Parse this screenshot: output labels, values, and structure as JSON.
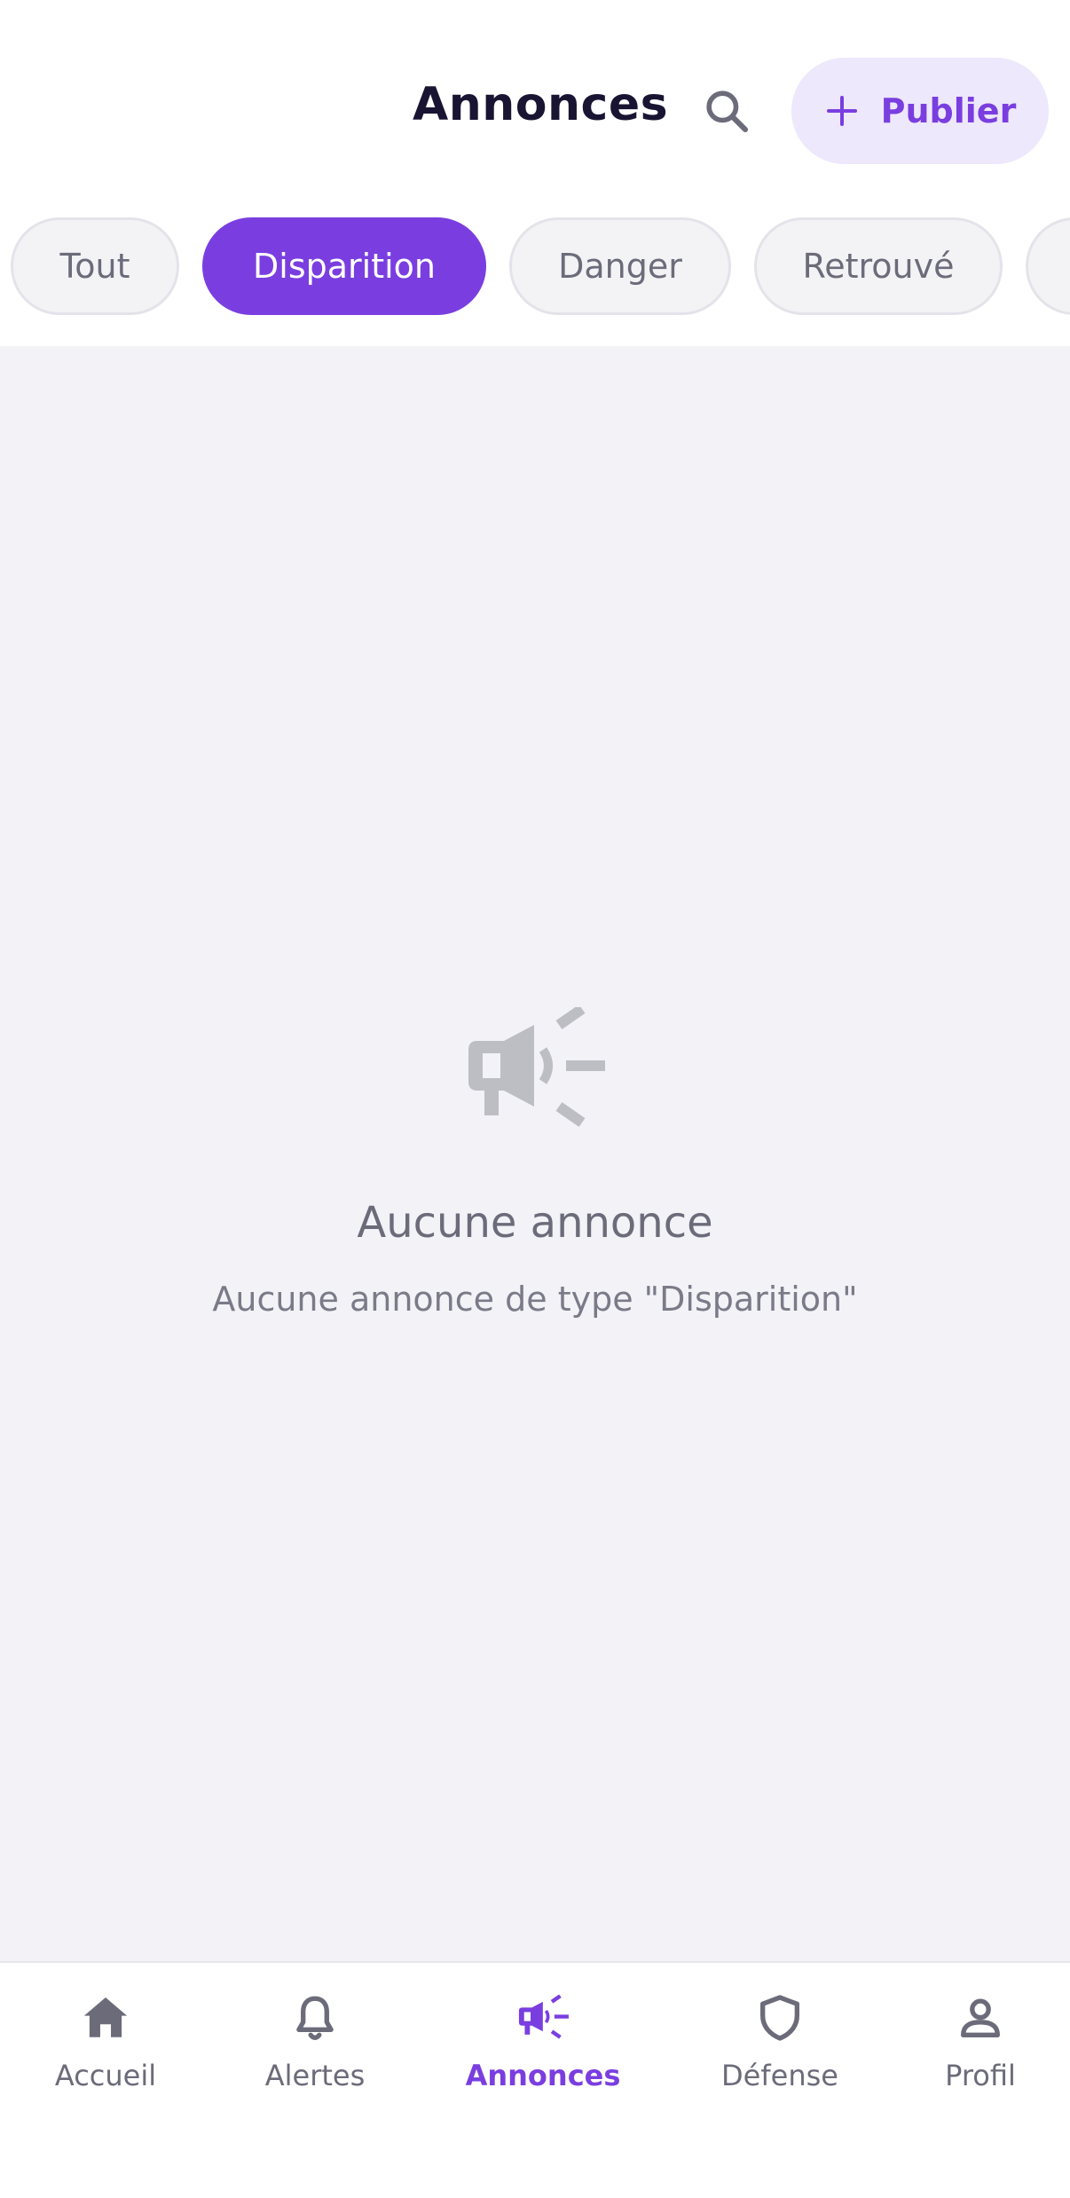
{
  "header": {
    "title": "Annonces",
    "search_icon": "search-icon",
    "publish_label": "Publier",
    "publish_icon": "plus-icon"
  },
  "filters": {
    "selected": "Disparition",
    "items": [
      {
        "label": "Tout"
      },
      {
        "label": "Disparition"
      },
      {
        "label": "Danger"
      },
      {
        "label": "Retrouvé"
      }
    ]
  },
  "empty_state": {
    "icon": "megaphone-icon",
    "title": "Aucune annonce",
    "subtitle": "Aucune annonce de type \"Disparition\""
  },
  "bottom_nav": {
    "active": "Annonces",
    "items": [
      {
        "label": "Accueil",
        "icon": "home-icon"
      },
      {
        "label": "Alertes",
        "icon": "bell-icon"
      },
      {
        "label": "Annonces",
        "icon": "megaphone-icon"
      },
      {
        "label": "Défense",
        "icon": "shield-icon"
      },
      {
        "label": "Profil",
        "icon": "user-icon"
      }
    ]
  },
  "colors": {
    "accent": "#7a3ee0",
    "accent_soft": "#ede8fb",
    "background": "#f2f2f7",
    "text_muted": "#6b6b7a",
    "title": "#1a1433"
  }
}
